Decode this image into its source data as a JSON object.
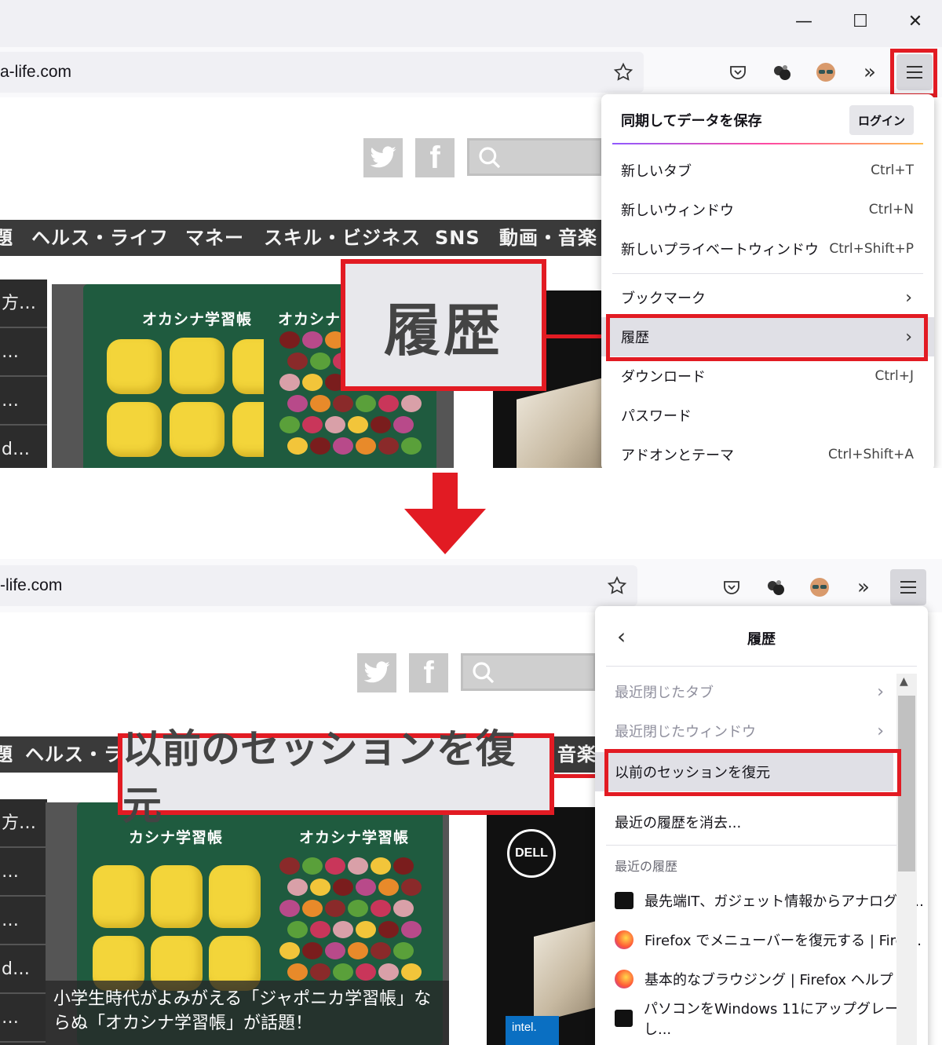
{
  "url_text": "a-life.com",
  "url_text_bottom": "-life.com",
  "window_controls": {
    "minimize": "—",
    "maximize": "☐",
    "close": "✕"
  },
  "toolbar_icons": [
    "star-icon",
    "pocket-icon",
    "extension-icon",
    "avatar-icon",
    "overflow-icon",
    "hamburger-menu-icon"
  ],
  "page": {
    "nav_items": [
      "題",
      "ヘルス・ライフ",
      "マネー",
      "スキル・ビジネス",
      "SNS",
      "動画・音楽"
    ],
    "nav_items_bottom": [
      "題",
      "ヘルス・ラ",
      "音楽"
    ],
    "side_list": [
      "方…",
      "…",
      "…",
      "d…"
    ],
    "side_list_bottom": [
      "方…",
      "…",
      "…",
      "d…",
      "…"
    ],
    "pack_title": "オカシナ学習帳",
    "pack_title_short": "オカシナ",
    "pack_title_partial": "カシナ学習帳",
    "article_caption": "小学生時代がよみがえる「ジャポニカ学習帳」ならぬ「オカシナ学習帳」が話題！",
    "ad_brand": "DELL",
    "ad_badge": "intel."
  },
  "main_menu": {
    "sync_label": "同期してデータを保存",
    "login_button": "ログイン",
    "items": [
      {
        "label": "新しいタブ",
        "shortcut": "Ctrl+T"
      },
      {
        "label": "新しいウィンドウ",
        "shortcut": "Ctrl+N"
      },
      {
        "label": "新しいプライベートウィンドウ",
        "shortcut": "Ctrl+Shift+P"
      },
      {
        "label": "ブックマーク",
        "shortcut": ""
      },
      {
        "label": "履歴",
        "shortcut": ""
      },
      {
        "label": "ダウンロード",
        "shortcut": "Ctrl+J"
      },
      {
        "label": "パスワード",
        "shortcut": ""
      },
      {
        "label": "アドオンとテーマ",
        "shortcut": "Ctrl+Shift+A"
      }
    ]
  },
  "history_menu": {
    "title": "履歴",
    "recent_tabs": "最近閉じたタブ",
    "recent_windows": "最近閉じたウィンドウ",
    "restore_session": "以前のセッションを復元",
    "clear_history": "最近の履歴を消去...",
    "recent_header": "最近の履歴",
    "recent_items": [
      {
        "icon": "otona-life-favicon",
        "label": "最先端IT、ガジェット情報からアナログ、..."
      },
      {
        "icon": "firefox-favicon",
        "label": "Firefox でメニューバーを復元する | Firef..."
      },
      {
        "icon": "firefox-favicon",
        "label": "基本的なブラウジング | Firefox ヘルプ"
      },
      {
        "icon": "otona-life-favicon",
        "label": "パソコンをWindows 11にアップグレードし..."
      }
    ]
  },
  "callouts": {
    "top": "履歴",
    "bottom": "以前のセッションを復元"
  },
  "colors": {
    "highlight": "#e21b23",
    "menu_bg": "#ffffff",
    "toolbar_bg": "#f9f9fb"
  }
}
